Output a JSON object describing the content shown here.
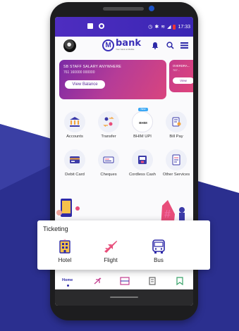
{
  "colors": {
    "brand": "#2e2aa8",
    "background_accent": "#2b2f8f",
    "card_gradient": "#b63c97"
  },
  "status_bar": {
    "time": "17:33"
  },
  "header": {
    "logo_text": "bank",
    "logo_tagline": "Your bank at Mobile",
    "icons": [
      "bell-icon",
      "search-icon",
      "menu-icon"
    ]
  },
  "balance_card": {
    "account_name": "SB STAFF SALARY ANYWHERE",
    "account_number": "761 160000 000000",
    "button_label": "View Balance"
  },
  "peek_card": {
    "title": "OVERDRA...",
    "number": "767...",
    "button_label": "View"
  },
  "services": [
    {
      "label": "Accounts",
      "icon": "bank-icon"
    },
    {
      "label": "Transfer",
      "icon": "transfer-icon"
    },
    {
      "label": "BHIM UPI",
      "icon": "bhim-upi-icon",
      "badge": "New",
      "logo_text": "BHIM"
    },
    {
      "label": "Bill Pay",
      "icon": "bill-icon"
    },
    {
      "label": "Debit Card",
      "icon": "card-icon"
    },
    {
      "label": "Cheques",
      "icon": "cheque-icon"
    },
    {
      "label": "Cordless Cash",
      "icon": "cash-icon"
    },
    {
      "label": "Other Services",
      "icon": "services-icon"
    }
  ],
  "ticketing": {
    "title": "Ticketing",
    "items": [
      {
        "label": "Hotel",
        "icon": "hotel-icon"
      },
      {
        "label": "Flight",
        "icon": "flight-icon"
      },
      {
        "label": "Bus",
        "icon": "bus-icon"
      }
    ]
  },
  "bottom_nav": {
    "home_label": "Home",
    "icons": [
      "flight-icon",
      "ticket-icon",
      "document-icon",
      "bookmark-icon"
    ]
  }
}
